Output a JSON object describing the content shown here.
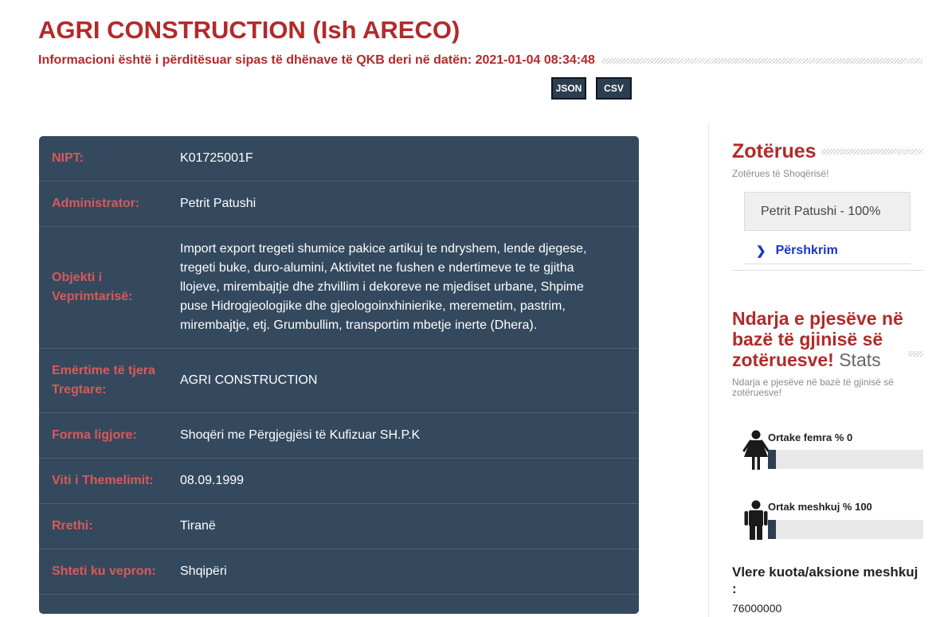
{
  "company": {
    "title": "AGRI CONSTRUCTION (Ish ARECO)",
    "update_info": "Informacioni është i përditësuar sipas të dhënave të QKB deri në datën: 2021-01-04 08:34:48"
  },
  "export": {
    "json_label": "JSON",
    "csv_label": "CSV"
  },
  "details": [
    {
      "label": "NIPT:",
      "value": "K01725001F"
    },
    {
      "label": "Administrator:",
      "value": "Petrit Patushi"
    },
    {
      "label": "Objekti i Veprimtarisë:",
      "value": "Import export tregeti shumice pakice artikuj te ndryshem, lende djegese, tregeti buke, duro-alumini, Aktivitet ne fushen e ndertimeve te te gjitha llojeve, mirembajtje dhe zhvillim i dekoreve ne mjediset urbane, Shpime puse Hidrogjeologjike dhe gjeologoinxhinierike, meremetim, pastrim, mirembajtje, etj. Grumbullim, transportim mbetje inerte (Dhera)."
    },
    {
      "label": "Emërtime të tjera Tregtare:",
      "value": "AGRI CONSTRUCTION"
    },
    {
      "label": "Forma ligjore:",
      "value": "Shoqëri me Përgjegjësi të Kufizuar SH.P.K"
    },
    {
      "label": "Viti i Themelimit:",
      "value": "08.09.1999"
    },
    {
      "label": "Rrethi:",
      "value": "Tiranë"
    },
    {
      "label": "Shteti ku vepron:",
      "value": "Shqipëri"
    }
  ],
  "sidebar": {
    "owners_title": "Zotërues",
    "owners_subtitle": "Zotërues të Shoqërisë!",
    "owner_entry": "Petrit Patushi - 100%",
    "description_link": "Përshkrim",
    "gender_title": "Ndarja e pjesëve në bazë të gjinisë së zotëruesve!",
    "gender_stats_word": "Stats",
    "gender_subtitle": "Ndarja e pjesëve në bazë të gjinisë së zotëruesve!",
    "female_label": "Ortake femra % 0",
    "female_pct": 0,
    "male_label": "Ortak meshkuj % 100",
    "male_pct": 100,
    "quota_title": "Vlere kuota/aksione meshkuj :",
    "quota_value": "76000000"
  },
  "colors": {
    "accent": "#b22a2a",
    "panel": "#34495e",
    "label": "#d9595a",
    "link": "#1a35c9"
  }
}
